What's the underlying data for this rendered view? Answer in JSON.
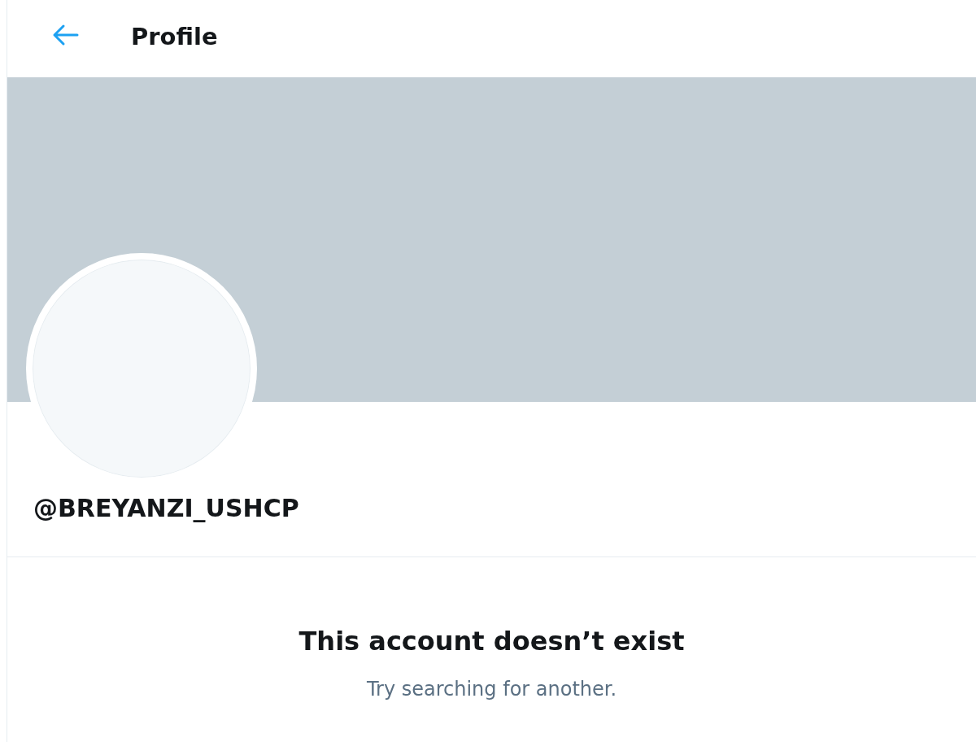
{
  "header": {
    "title": "Profile"
  },
  "profile": {
    "handle": "@BREYANZI_USHCP"
  },
  "empty_state": {
    "title": "This account doesn’t exist",
    "subtitle": "Try searching for another."
  }
}
